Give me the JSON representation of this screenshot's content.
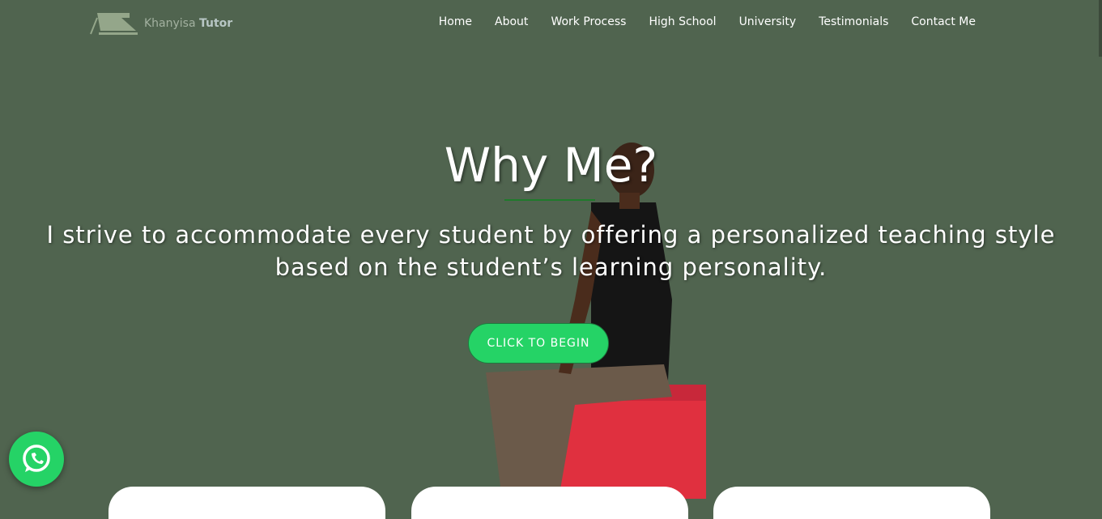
{
  "logo": {
    "name_part1": "Khanyisa",
    "name_part2": "Tutor"
  },
  "nav": [
    "Home",
    "About",
    "Work Process",
    "High School",
    "University",
    "Testimonials",
    "Contact Me"
  ],
  "hero": {
    "title": "Why Me?",
    "lead": "I strive to accommodate every student by offering a personalized teaching style based on the student’s learning personality.",
    "cta": "CLICK TO BEGIN"
  },
  "colors": {
    "background": "#50644f",
    "accent": "#25d366"
  }
}
